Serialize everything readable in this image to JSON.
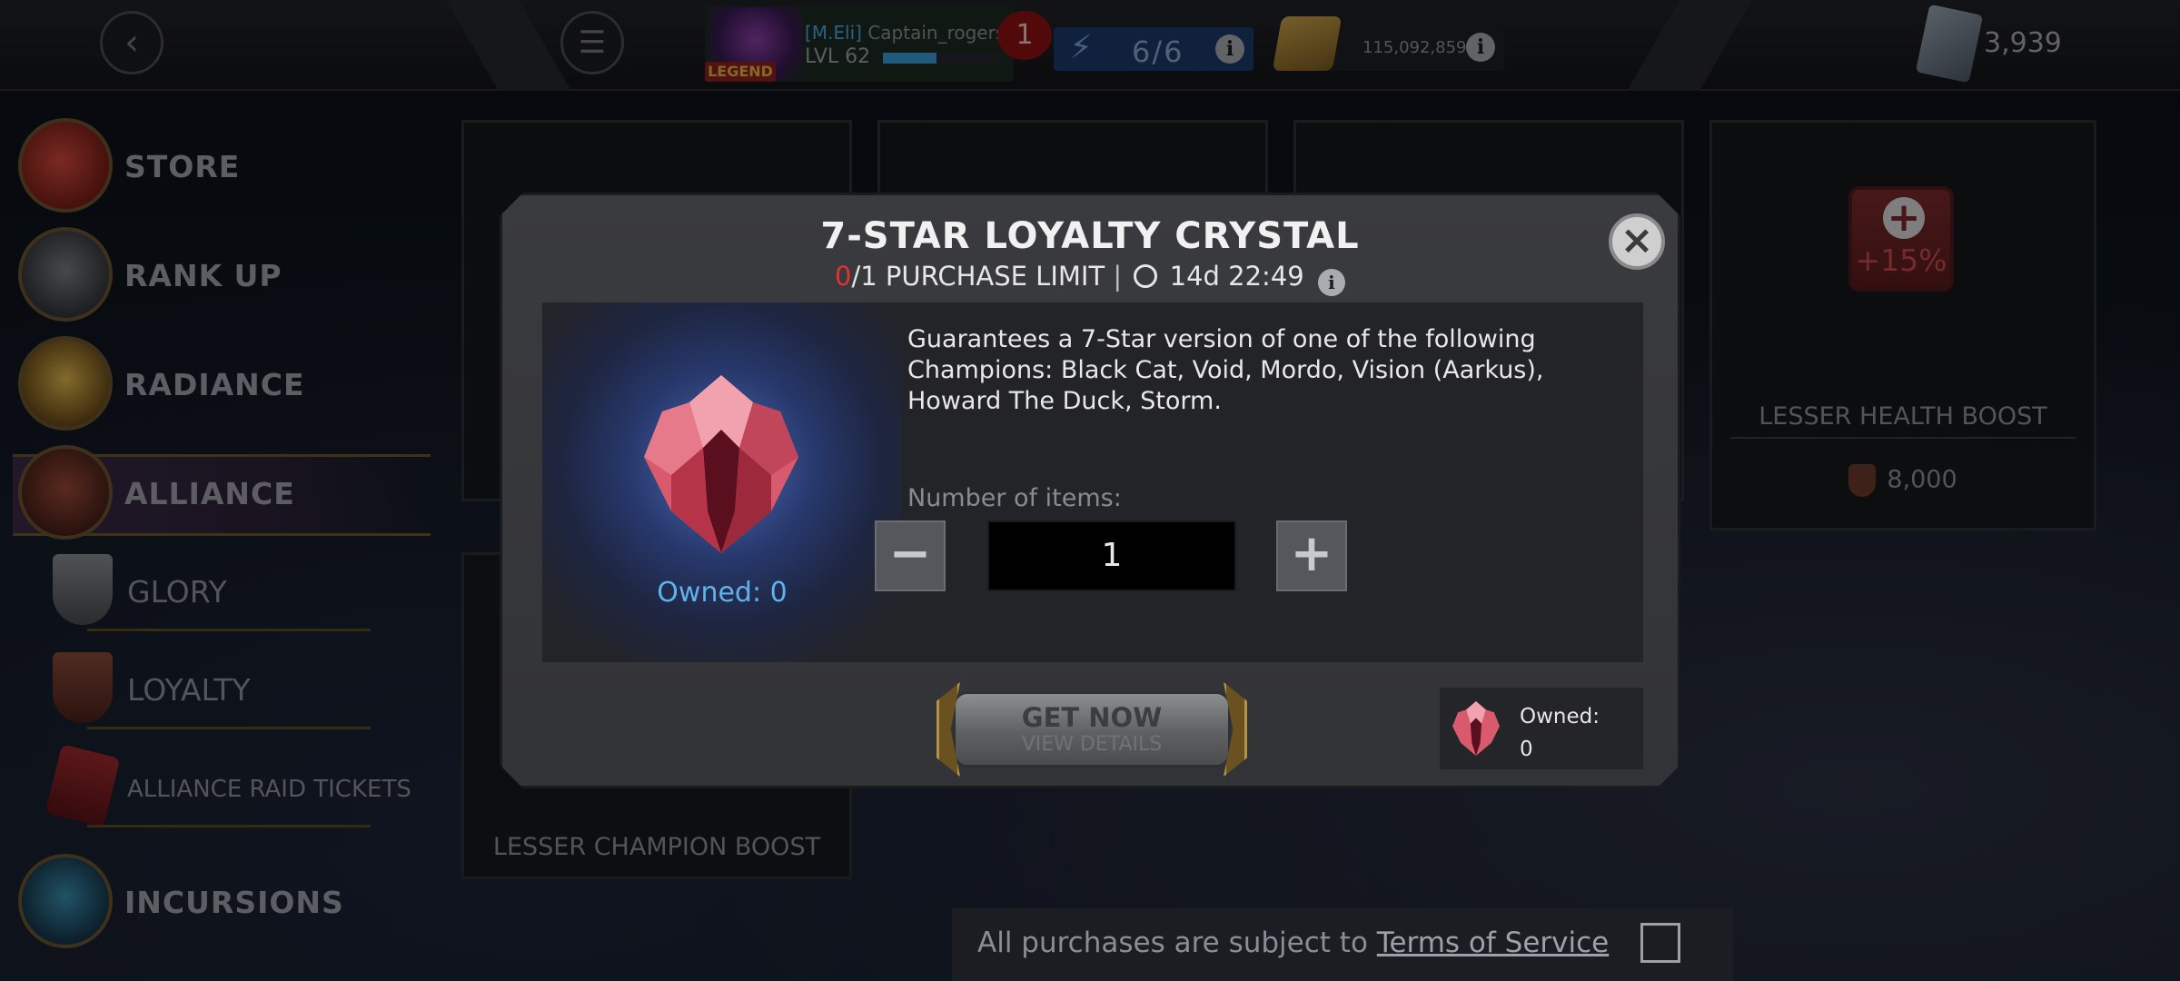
{
  "topbar": {
    "player_tag": "[M.Eli]",
    "player_name": "Captain_rogers",
    "level": "LVL 62",
    "xp_fraction": 0.45,
    "badge": "LEGEND",
    "notifications": "1",
    "energy": "6/6",
    "gold": "115,092,859",
    "units": "3,939"
  },
  "sidebar": {
    "items": [
      {
        "label": "STORE"
      },
      {
        "label": "RANK UP"
      },
      {
        "label": "RADIANCE"
      },
      {
        "label": "ALLIANCE"
      },
      {
        "label": "GLORY"
      },
      {
        "label": "LOYALTY"
      },
      {
        "label": "ALLIANCE RAID TICKETS"
      },
      {
        "label": "INCURSIONS"
      }
    ]
  },
  "store": {
    "cards": [
      {
        "title": "LESSER HEALTH BOOST",
        "value": "+15%",
        "price": "8,000"
      },
      {
        "title": "LESSER CHAMPION BOOST"
      }
    ]
  },
  "footer": {
    "text": "All purchases are subject to",
    "link": "Terms of Service"
  },
  "modal": {
    "title": "7-STAR LOYALTY CRYSTAL",
    "purchased": "0",
    "limit_text": "/1 PURCHASE LIMIT",
    "separator": "|",
    "timer": "14d 22:49",
    "description": "Guarantees a 7-Star version of one of the following Champions: Black Cat, Void, Mordo, Vision (Aarkus), Howard The Duck, Storm.",
    "owned_label": "Owned: 0",
    "quantity_label": "Number of items:",
    "quantity": "1",
    "minus": "−",
    "plus": "+",
    "get_now": "GET NOW",
    "view_details": "VIEW DETAILS",
    "owned_small_label": "Owned:",
    "owned_small_value": "0"
  },
  "colors": {
    "accent_blue": "#5fb2ea",
    "limit_red": "#e0332f",
    "modal_bg": "#3a3b3e"
  }
}
